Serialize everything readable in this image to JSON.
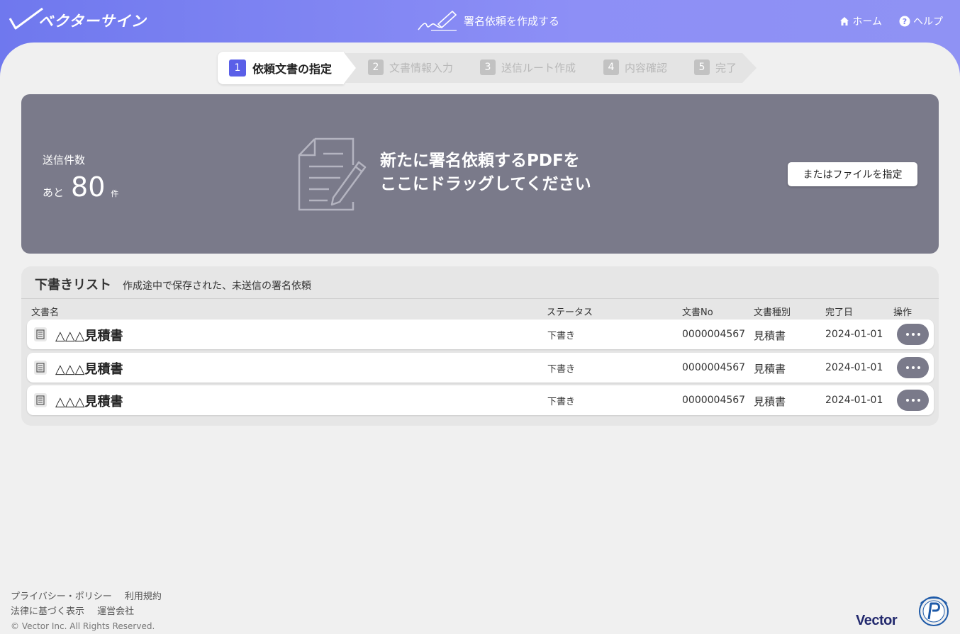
{
  "header": {
    "logo_text": "ベクターサイン",
    "title": "署名依頼を作成する",
    "nav": [
      {
        "label": "ホーム",
        "icon": "home-icon"
      },
      {
        "label": "ヘルプ",
        "icon": "help-icon"
      }
    ]
  },
  "stepper": {
    "steps": [
      {
        "num": "1",
        "label": "依頼文書の指定",
        "active": true
      },
      {
        "num": "2",
        "label": "文書情報入力",
        "active": false
      },
      {
        "num": "3",
        "label": "送信ルート作成",
        "active": false
      },
      {
        "num": "4",
        "label": "内容確認",
        "active": false
      },
      {
        "num": "5",
        "label": "完了",
        "active": false
      }
    ]
  },
  "dropzone": {
    "quota_label": "送信件数",
    "quota_prefix": "あと",
    "quota_number": "80",
    "quota_unit": "件",
    "drop_line1": "新たに署名依頼するPDFを",
    "drop_line2": "ここにドラッグしてください",
    "file_button": "またはファイルを指定"
  },
  "drafts": {
    "title": "下書きリスト",
    "subtitle": "作成途中で保存された、未送信の署名依頼",
    "columns": [
      "文書名",
      "ステータス",
      "文書No",
      "文書種別",
      "完了日",
      "操作"
    ],
    "rows": [
      {
        "name": "△△△見積書",
        "status": "下書き",
        "doc_no": "0000004567",
        "kind": "見積書",
        "date": "2024-01-01"
      },
      {
        "name": "△△△見積書",
        "status": "下書き",
        "doc_no": "0000004567",
        "kind": "見積書",
        "date": "2024-01-01"
      },
      {
        "name": "△△△見積書",
        "status": "下書き",
        "doc_no": "0000004567",
        "kind": "見積書",
        "date": "2024-01-01"
      }
    ]
  },
  "footer": {
    "links_row1": [
      "プライバシー・ポリシー",
      "利用規約"
    ],
    "links_row2": [
      "法律に基づく表示",
      "運営会社"
    ],
    "copyright": "© Vector Inc. All Rights Reserved.",
    "brand": "Vector"
  },
  "colors": {
    "accent": "#5a5fe8",
    "header_gradient_start": "#6f78ee",
    "header_gradient_end": "#8f92f4",
    "dropzone_bg": "#7a7a8a"
  }
}
